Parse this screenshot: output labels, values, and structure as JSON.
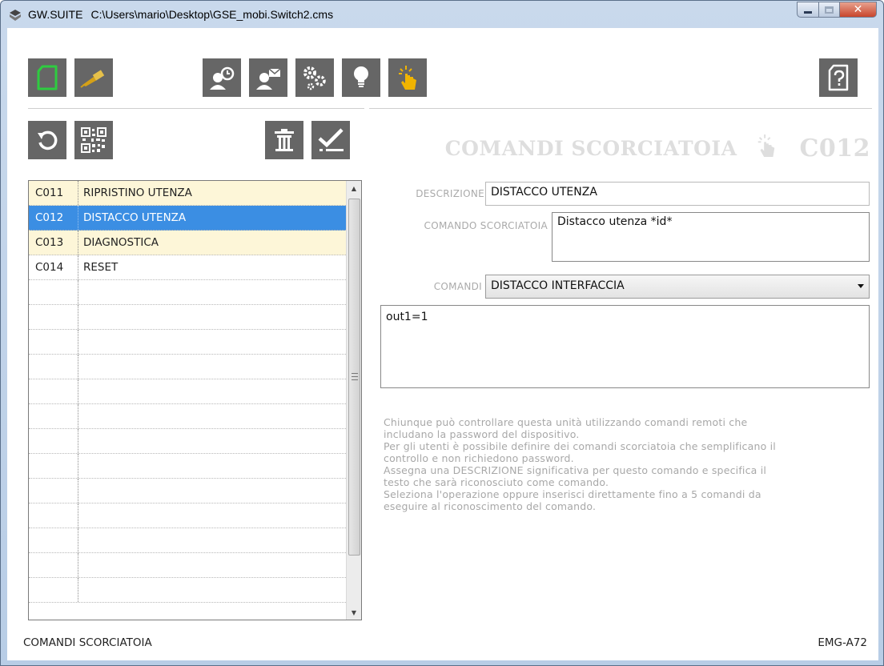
{
  "window": {
    "app_name": "GW.SUITE",
    "file_path": "C:\\Users\\mario\\Desktop\\GSE_mobi.Switch2.cms"
  },
  "toolbar": {
    "top_icons": [
      "new-file-icon",
      "usb-connect-icon",
      "user-time-icon",
      "user-mail-icon",
      "settings-gears-icon",
      "lightbulb-icon",
      "touch-hand-icon",
      "help-file-icon"
    ],
    "list_icons": [
      "reset-icon",
      "qr-code-icon",
      "trash-icon",
      "checkmark-icon"
    ],
    "new_icon_color": "#2ecc40",
    "usb_icon_color": "#d4a017",
    "hand_icon_color": "#f0b400"
  },
  "section": {
    "title": "COMANDI SCORCIATOIA",
    "code": "C012"
  },
  "list": {
    "rows": [
      {
        "code": "C011",
        "name": "RIPRISTINO UTENZA",
        "state": "yellow"
      },
      {
        "code": "C012",
        "name": "DISTACCO UTENZA",
        "state": "selected"
      },
      {
        "code": "C013",
        "name": "DIAGNOSTICA",
        "state": "yellow"
      },
      {
        "code": "C014",
        "name": "RESET",
        "state": "normal"
      }
    ],
    "selected_color": "#3b8ee3",
    "highlight_color": "#fdf6d8"
  },
  "form": {
    "descrizione_label": "DESCRIZIONE",
    "descrizione_value": "DISTACCO UTENZA",
    "comando_label": "COMANDO SCORCIATOIA",
    "comando_value": "Distacco utenza *id*",
    "comandi_label": "COMANDI",
    "comandi_selected": "DISTACCO INTERFACCIA",
    "commands_text": "out1=1"
  },
  "help_text": "Chiunque può controllare questa unità utilizzando comandi remoti che\nincludano la password del dispositivo.\nPer gli utenti è possibile definire dei comandi scorciatoia che semplificano il\ncontrollo e non richiedono password.\nAssegna una DESCRIZIONE significativa per questo comando e specifica il\ntesto che sarà riconosciuto come comando.\nSeleziona l'operazione oppure inserisci direttamente fino a 5 comandi da\neseguire al riconoscimento del comando.",
  "status": {
    "left": "COMANDI SCORCIATOIA",
    "right": "EMG-A72"
  }
}
